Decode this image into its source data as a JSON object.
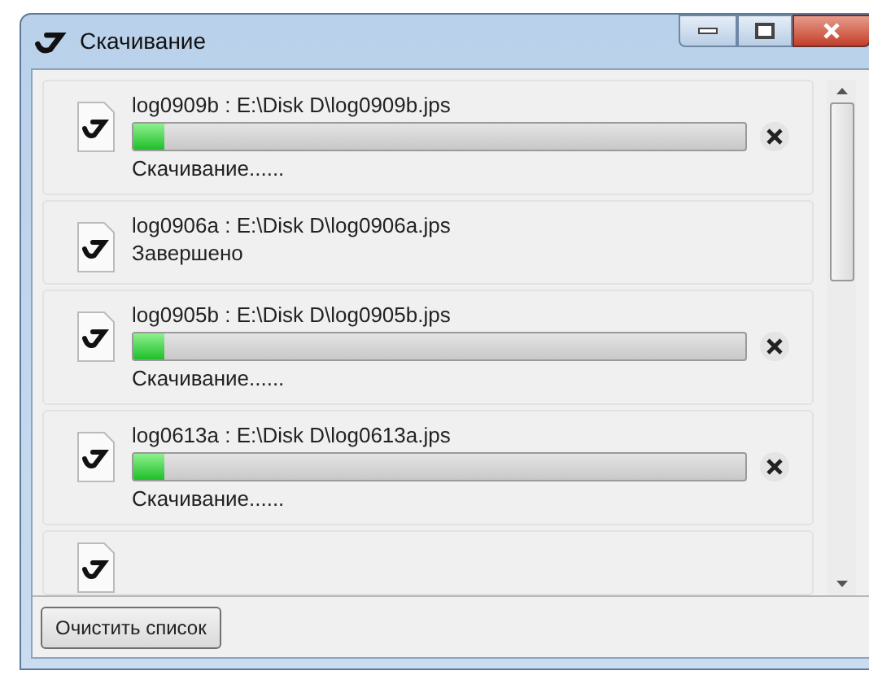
{
  "window": {
    "title": "Скачивание"
  },
  "downloads": [
    {
      "name": "log0909b : E:\\Disk D\\log0909b.jps",
      "status": "Скачивание......",
      "kind": "progress",
      "level": 0.05
    },
    {
      "name": "log0906a : E:\\Disk D\\log0906a.jps",
      "status": "Завершено",
      "kind": "done"
    },
    {
      "name": "log0905b : E:\\Disk D\\log0905b.jps",
      "status": "Скачивание......",
      "kind": "progress",
      "level": 0.05
    },
    {
      "name": "log0613a : E:\\Disk D\\log0613a.jps",
      "status": "Скачивание......",
      "kind": "progress",
      "level": 0.05
    }
  ],
  "clear_button": "Очистить список"
}
